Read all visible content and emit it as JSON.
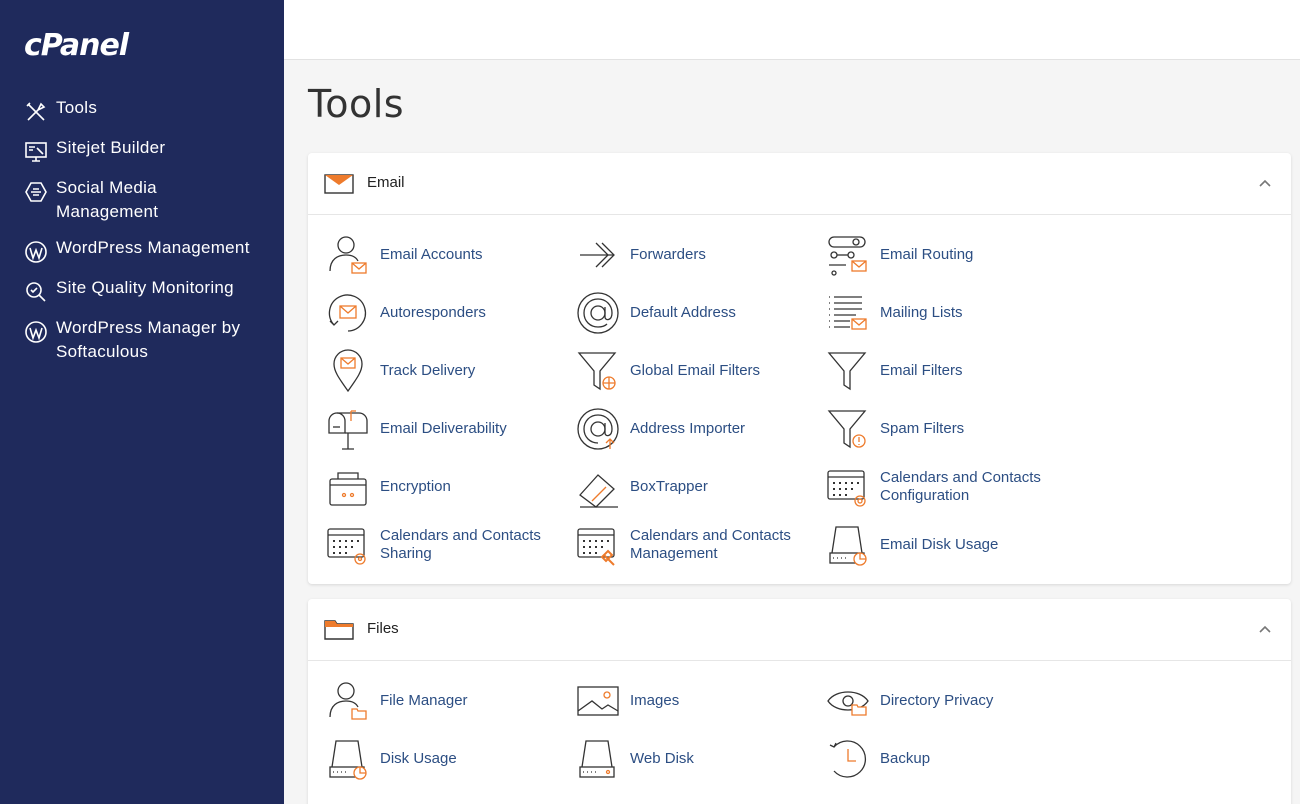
{
  "brand": {
    "logo_text": "cPanel"
  },
  "sidebar": {
    "items": [
      {
        "label": "Tools",
        "icon": "tools-icon"
      },
      {
        "label": "Sitejet Builder",
        "icon": "monitor-icon"
      },
      {
        "label": "Social Media Management",
        "icon": "social-icon"
      },
      {
        "label": "WordPress Management",
        "icon": "wordpress-icon"
      },
      {
        "label": "Site Quality Monitoring",
        "icon": "magnifier-icon"
      },
      {
        "label": "WordPress Manager by Softaculous",
        "icon": "wordpress-icon"
      }
    ]
  },
  "page": {
    "title": "Tools"
  },
  "sections": {
    "email": {
      "title": "Email",
      "tools": [
        {
          "label": "Email Accounts",
          "icon": "user-mail-icon"
        },
        {
          "label": "Forwarders",
          "icon": "forward-arrow-icon"
        },
        {
          "label": "Email Routing",
          "icon": "routing-icon"
        },
        {
          "label": "Autoresponders",
          "icon": "autoresponder-icon"
        },
        {
          "label": "Default Address",
          "icon": "at-sign-icon"
        },
        {
          "label": "Mailing Lists",
          "icon": "mailing-list-icon"
        },
        {
          "label": "Track Delivery",
          "icon": "location-pin-icon"
        },
        {
          "label": "Global Email Filters",
          "icon": "global-filter-icon"
        },
        {
          "label": "Email Filters",
          "icon": "filter-icon"
        },
        {
          "label": "Email Deliverability",
          "icon": "mailbox-icon"
        },
        {
          "label": "Address Importer",
          "icon": "at-import-icon"
        },
        {
          "label": "Spam Filters",
          "icon": "spam-filter-icon"
        },
        {
          "label": "Encryption",
          "icon": "encryption-icon"
        },
        {
          "label": "BoxTrapper",
          "icon": "boxtrapper-icon"
        },
        {
          "label": "Calendars and Contacts Configuration",
          "icon": "calendar-config-icon"
        },
        {
          "label": "Calendars and Contacts Sharing",
          "icon": "calendar-share-icon"
        },
        {
          "label": "Calendars and Contacts Management",
          "icon": "calendar-manage-icon"
        },
        {
          "label": "Email Disk Usage",
          "icon": "disk-usage-icon"
        }
      ]
    },
    "files": {
      "title": "Files",
      "tools": [
        {
          "label": "File Manager",
          "icon": "user-folder-icon"
        },
        {
          "label": "Images",
          "icon": "image-icon"
        },
        {
          "label": "Directory Privacy",
          "icon": "eye-folder-icon"
        },
        {
          "label": "Disk Usage",
          "icon": "disk-icon"
        },
        {
          "label": "Web Disk",
          "icon": "web-disk-icon"
        },
        {
          "label": "Backup",
          "icon": "backup-clock-icon"
        }
      ]
    }
  },
  "colors": {
    "sidebar_bg": "#1f2a5c",
    "link": "#2c4e83",
    "accent": "#ee7b2c"
  }
}
